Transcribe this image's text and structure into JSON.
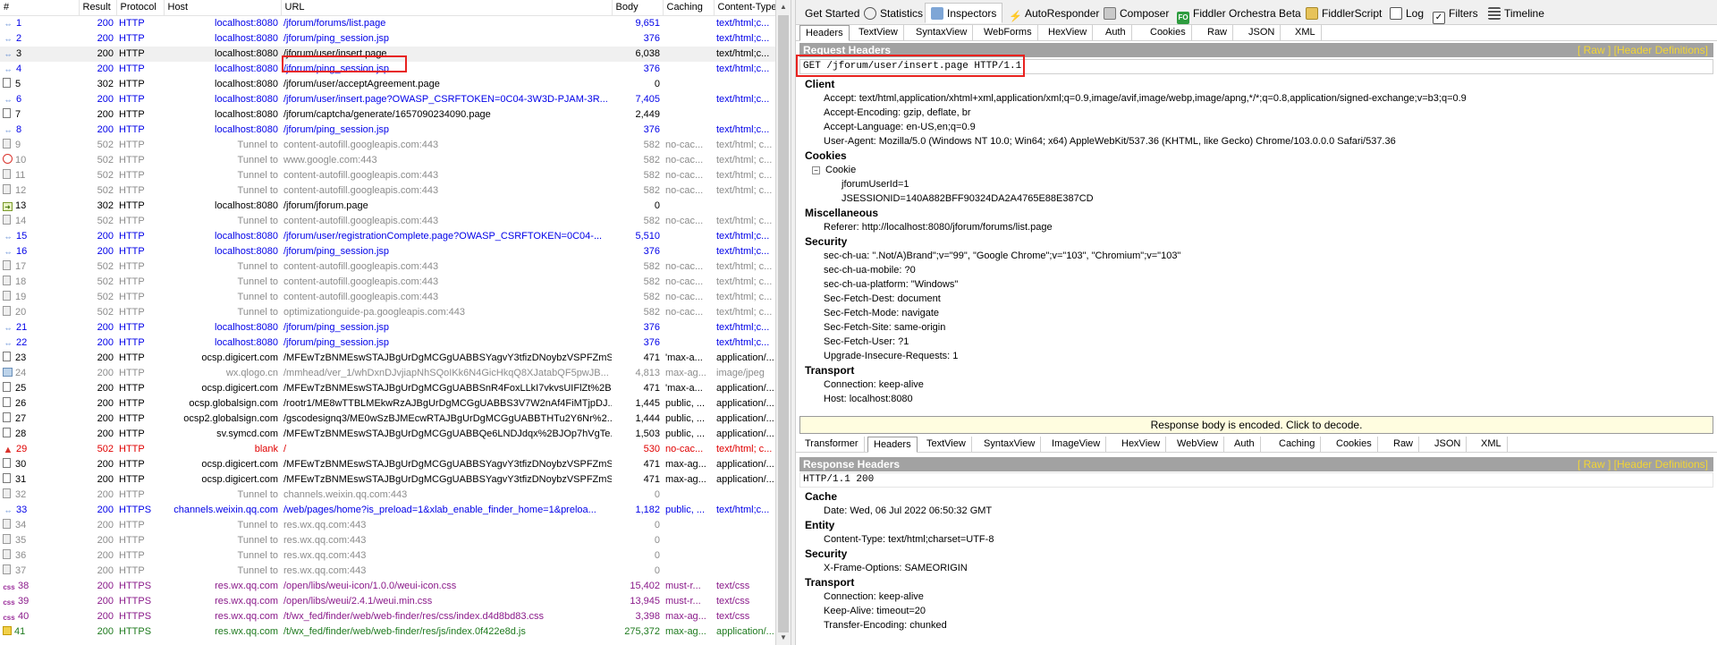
{
  "sessions": {
    "columns": [
      "#",
      "Result",
      "Protocol",
      "Host",
      "URL",
      "Body",
      "Caching",
      "Content-Type"
    ],
    "rows": [
      {
        "n": "1",
        "result": "200",
        "protocol": "HTTP",
        "host": "localhost:8080",
        "url": "/jforum/forums/list.page",
        "body": "9,651",
        "caching": "",
        "ctype": "text/html;c...",
        "color": "blue",
        "icon": "arrows"
      },
      {
        "n": "2",
        "result": "200",
        "protocol": "HTTP",
        "host": "localhost:8080",
        "url": "/jforum/ping_session.jsp",
        "body": "376",
        "caching": "",
        "ctype": "text/html;c...",
        "color": "blue",
        "icon": "arrows"
      },
      {
        "n": "3",
        "result": "200",
        "protocol": "HTTP",
        "host": "localhost:8080",
        "url": "/jforum/user/insert.page",
        "body": "6,038",
        "caching": "",
        "ctype": "text/html;c...",
        "color": "black",
        "icon": "arrows",
        "selected": true
      },
      {
        "n": "4",
        "result": "200",
        "protocol": "HTTP",
        "host": "localhost:8080",
        "url": "/jforum/ping_session.jsp",
        "body": "376",
        "caching": "",
        "ctype": "text/html;c...",
        "color": "blue",
        "icon": "arrows"
      },
      {
        "n": "5",
        "result": "302",
        "protocol": "HTTP",
        "host": "localhost:8080",
        "url": "/jforum/user/acceptAgreement.page",
        "body": "0",
        "caching": "",
        "ctype": "",
        "color": "black",
        "icon": "page"
      },
      {
        "n": "6",
        "result": "200",
        "protocol": "HTTP",
        "host": "localhost:8080",
        "url": "/jforum/user/insert.page?OWASP_CSRFTOKEN=0C04-3W3D-PJAM-3R...",
        "body": "7,405",
        "caching": "",
        "ctype": "text/html;c...",
        "color": "blue",
        "icon": "arrows"
      },
      {
        "n": "7",
        "result": "200",
        "protocol": "HTTP",
        "host": "localhost:8080",
        "url": "/jforum/captcha/generate/1657090234090.page",
        "body": "2,449",
        "caching": "",
        "ctype": "",
        "color": "black",
        "icon": "page"
      },
      {
        "n": "8",
        "result": "200",
        "protocol": "HTTP",
        "host": "localhost:8080",
        "url": "/jforum/ping_session.jsp",
        "body": "376",
        "caching": "",
        "ctype": "text/html;c...",
        "color": "blue",
        "icon": "arrows"
      },
      {
        "n": "9",
        "result": "502",
        "protocol": "HTTP",
        "host": "Tunnel to",
        "url": "content-autofill.googleapis.com:443",
        "body": "582",
        "caching": "no-cac...",
        "ctype": "text/html; c...",
        "color": "gray",
        "icon": "lock"
      },
      {
        "n": "10",
        "result": "502",
        "protocol": "HTTP",
        "host": "Tunnel to",
        "url": "www.google.com:443",
        "body": "582",
        "caching": "no-cac...",
        "ctype": "text/html; c...",
        "color": "gray",
        "icon": "block"
      },
      {
        "n": "11",
        "result": "502",
        "protocol": "HTTP",
        "host": "Tunnel to",
        "url": "content-autofill.googleapis.com:443",
        "body": "582",
        "caching": "no-cac...",
        "ctype": "text/html; c...",
        "color": "gray",
        "icon": "lock"
      },
      {
        "n": "12",
        "result": "502",
        "protocol": "HTTP",
        "host": "Tunnel to",
        "url": "content-autofill.googleapis.com:443",
        "body": "582",
        "caching": "no-cac...",
        "ctype": "text/html; c...",
        "color": "gray",
        "icon": "lock"
      },
      {
        "n": "13",
        "result": "302",
        "protocol": "HTTP",
        "host": "localhost:8080",
        "url": "/jforum/jforum.page",
        "body": "0",
        "caching": "",
        "ctype": "",
        "color": "black",
        "icon": "redirect"
      },
      {
        "n": "14",
        "result": "502",
        "protocol": "HTTP",
        "host": "Tunnel to",
        "url": "content-autofill.googleapis.com:443",
        "body": "582",
        "caching": "no-cac...",
        "ctype": "text/html; c...",
        "color": "gray",
        "icon": "lock"
      },
      {
        "n": "15",
        "result": "200",
        "protocol": "HTTP",
        "host": "localhost:8080",
        "url": "/jforum/user/registrationComplete.page?OWASP_CSRFTOKEN=0C04-...",
        "body": "5,510",
        "caching": "",
        "ctype": "text/html;c...",
        "color": "blue",
        "icon": "arrows"
      },
      {
        "n": "16",
        "result": "200",
        "protocol": "HTTP",
        "host": "localhost:8080",
        "url": "/jforum/ping_session.jsp",
        "body": "376",
        "caching": "",
        "ctype": "text/html;c...",
        "color": "blue",
        "icon": "arrows"
      },
      {
        "n": "17",
        "result": "502",
        "protocol": "HTTP",
        "host": "Tunnel to",
        "url": "content-autofill.googleapis.com:443",
        "body": "582",
        "caching": "no-cac...",
        "ctype": "text/html; c...",
        "color": "gray",
        "icon": "lock"
      },
      {
        "n": "18",
        "result": "502",
        "protocol": "HTTP",
        "host": "Tunnel to",
        "url": "content-autofill.googleapis.com:443",
        "body": "582",
        "caching": "no-cac...",
        "ctype": "text/html; c...",
        "color": "gray",
        "icon": "lock"
      },
      {
        "n": "19",
        "result": "502",
        "protocol": "HTTP",
        "host": "Tunnel to",
        "url": "content-autofill.googleapis.com:443",
        "body": "582",
        "caching": "no-cac...",
        "ctype": "text/html; c...",
        "color": "gray",
        "icon": "lock"
      },
      {
        "n": "20",
        "result": "502",
        "protocol": "HTTP",
        "host": "Tunnel to",
        "url": "optimizationguide-pa.googleapis.com:443",
        "body": "582",
        "caching": "no-cac...",
        "ctype": "text/html; c...",
        "color": "gray",
        "icon": "lock"
      },
      {
        "n": "21",
        "result": "200",
        "protocol": "HTTP",
        "host": "localhost:8080",
        "url": "/jforum/ping_session.jsp",
        "body": "376",
        "caching": "",
        "ctype": "text/html;c...",
        "color": "blue",
        "icon": "arrows"
      },
      {
        "n": "22",
        "result": "200",
        "protocol": "HTTP",
        "host": "localhost:8080",
        "url": "/jforum/ping_session.jsp",
        "body": "376",
        "caching": "",
        "ctype": "text/html;c...",
        "color": "blue",
        "icon": "arrows"
      },
      {
        "n": "23",
        "result": "200",
        "protocol": "HTTP",
        "host": "ocsp.digicert.com",
        "url": "/MFEwTzBNMEswSTAJBgUrDgMCGgUABBSYagvY3tfizDNoybzVSPFZmS...",
        "body": "471",
        "caching": "'max-a...",
        "ctype": "application/...",
        "color": "black",
        "icon": "page"
      },
      {
        "n": "24",
        "result": "200",
        "protocol": "HTTP",
        "host": "wx.qlogo.cn",
        "url": "/mmhead/ver_1/whDxnDJvjiapNhSQoIKk6N4GicHkqQ8XJatabQF5pwJB...",
        "body": "4,813",
        "caching": "max-ag...",
        "ctype": "image/jpeg",
        "color": "dim",
        "icon": "img"
      },
      {
        "n": "25",
        "result": "200",
        "protocol": "HTTP",
        "host": "ocsp.digicert.com",
        "url": "/MFEwTzBNMEswSTAJBgUrDgMCGgUABBSnR4FoxLLkI7vkvsUIFlZt%2B...",
        "body": "471",
        "caching": "'max-a...",
        "ctype": "application/...",
        "color": "black",
        "icon": "page"
      },
      {
        "n": "26",
        "result": "200",
        "protocol": "HTTP",
        "host": "ocsp.globalsign.com",
        "url": "/rootr1/ME8wTTBLMEkwRzAJBgUrDgMCGgUABBS3V7W2nAf4FiMTjpDJ...",
        "body": "1,445",
        "caching": "public, ...",
        "ctype": "application/...",
        "color": "black",
        "icon": "page"
      },
      {
        "n": "27",
        "result": "200",
        "protocol": "HTTP",
        "host": "ocsp2.globalsign.com",
        "url": "/gscodesignq3/ME0wSzBJMEcwRTAJBgUrDgMCGgUABBTHTu2Y6Nr%2...",
        "body": "1,444",
        "caching": "public, ...",
        "ctype": "application/...",
        "color": "black",
        "icon": "page"
      },
      {
        "n": "28",
        "result": "200",
        "protocol": "HTTP",
        "host": "sv.symcd.com",
        "url": "/MFEwTzBNMEswSTAJBgUrDgMCGgUABBQe6LNDJdqx%2BJOp7hVgTe...",
        "body": "1,503",
        "caching": "public, ...",
        "ctype": "application/...",
        "color": "black",
        "icon": "page"
      },
      {
        "n": "29",
        "result": "502",
        "protocol": "HTTP",
        "host": "blank",
        "url": "/",
        "body": "530",
        "caching": "no-cac...",
        "ctype": "text/html; c...",
        "color": "red",
        "icon": "warn"
      },
      {
        "n": "30",
        "result": "200",
        "protocol": "HTTP",
        "host": "ocsp.digicert.com",
        "url": "/MFEwTzBNMEswSTAJBgUrDgMCGgUABBSYagvY3tfizDNoybzVSPFZmS...",
        "body": "471",
        "caching": "max-ag...",
        "ctype": "application/...",
        "color": "black",
        "icon": "page"
      },
      {
        "n": "31",
        "result": "200",
        "protocol": "HTTP",
        "host": "ocsp.digicert.com",
        "url": "/MFEwTzBNMEswSTAJBgUrDgMCGgUABBSYagvY3tfizDNoybzVSPFZmS...",
        "body": "471",
        "caching": "max-ag...",
        "ctype": "application/...",
        "color": "black",
        "icon": "page"
      },
      {
        "n": "32",
        "result": "200",
        "protocol": "HTTP",
        "host": "Tunnel to",
        "url": "channels.weixin.qq.com:443",
        "body": "0",
        "caching": "",
        "ctype": "",
        "color": "gray",
        "icon": "lock"
      },
      {
        "n": "33",
        "result": "200",
        "protocol": "HTTPS",
        "host": "channels.weixin.qq.com",
        "url": "/web/pages/home?is_preload=1&xlab_enable_finder_home=1&preloa...",
        "body": "1,182",
        "caching": "public, ...",
        "ctype": "text/html;c...",
        "color": "blue",
        "icon": "arrows"
      },
      {
        "n": "34",
        "result": "200",
        "protocol": "HTTP",
        "host": "Tunnel to",
        "url": "res.wx.qq.com:443",
        "body": "0",
        "caching": "",
        "ctype": "",
        "color": "gray",
        "icon": "lock"
      },
      {
        "n": "35",
        "result": "200",
        "protocol": "HTTP",
        "host": "Tunnel to",
        "url": "res.wx.qq.com:443",
        "body": "0",
        "caching": "",
        "ctype": "",
        "color": "gray",
        "icon": "lock"
      },
      {
        "n": "36",
        "result": "200",
        "protocol": "HTTP",
        "host": "Tunnel to",
        "url": "res.wx.qq.com:443",
        "body": "0",
        "caching": "",
        "ctype": "",
        "color": "gray",
        "icon": "lock"
      },
      {
        "n": "37",
        "result": "200",
        "protocol": "HTTP",
        "host": "Tunnel to",
        "url": "res.wx.qq.com:443",
        "body": "0",
        "caching": "",
        "ctype": "",
        "color": "gray",
        "icon": "lock"
      },
      {
        "n": "38",
        "result": "200",
        "protocol": "HTTPS",
        "host": "res.wx.qq.com",
        "url": "/open/libs/weui-icon/1.0.0/weui-icon.css",
        "body": "15,402",
        "caching": "must-r...",
        "ctype": "text/css",
        "color": "purple",
        "icon": "css"
      },
      {
        "n": "39",
        "result": "200",
        "protocol": "HTTPS",
        "host": "res.wx.qq.com",
        "url": "/open/libs/weui/2.4.1/weui.min.css",
        "body": "13,945",
        "caching": "must-r...",
        "ctype": "text/css",
        "color": "purple",
        "icon": "css"
      },
      {
        "n": "40",
        "result": "200",
        "protocol": "HTTPS",
        "host": "res.wx.qq.com",
        "url": "/t/wx_fed/finder/web/web-finder/res/css/index.d4d8bd83.css",
        "body": "3,398",
        "caching": "max-ag...",
        "ctype": "text/css",
        "color": "purple",
        "icon": "css"
      },
      {
        "n": "41",
        "result": "200",
        "protocol": "HTTPS",
        "host": "res.wx.qq.com",
        "url": "/t/wx_fed/finder/web/web-finder/res/js/index.0f422e8d.js",
        "body": "275,372",
        "caching": "max-ag...",
        "ctype": "application/...",
        "color": "green",
        "icon": "js"
      }
    ]
  },
  "top_tabs": [
    {
      "label": "Get Started",
      "icon": ""
    },
    {
      "label": "Statistics",
      "icon": "stats-icon"
    },
    {
      "label": "Inspectors",
      "icon": "inspect-icon",
      "active": true
    },
    {
      "label": "AutoResponder",
      "icon": "bolt-icon"
    },
    {
      "label": "Composer",
      "icon": "compose-icon"
    },
    {
      "label": "Fiddler Orchestra Beta",
      "icon": "fo-icon"
    },
    {
      "label": "FiddlerScript",
      "icon": "script-icon"
    },
    {
      "label": "Log",
      "icon": "log-icon"
    },
    {
      "label": "Filters",
      "icon": "filter-icon"
    },
    {
      "label": "Timeline",
      "icon": "timeline-icon"
    }
  ],
  "request_tabs": [
    "Headers",
    "TextView",
    "SyntaxView",
    "WebForms",
    "HexView",
    "Auth",
    "Cookies",
    "Raw",
    "JSON",
    "XML"
  ],
  "request": {
    "title": "Request Headers",
    "links": "[ Raw ]   [Header Definitions]",
    "line": "GET /jforum/user/insert.page HTTP/1.1",
    "client_label": "Client",
    "client": [
      "Accept: text/html,application/xhtml+xml,application/xml;q=0.9,image/avif,image/webp,image/apng,*/*;q=0.8,application/signed-exchange;v=b3;q=0.9",
      "Accept-Encoding: gzip, deflate, br",
      "Accept-Language: en-US,en;q=0.9",
      "User-Agent: Mozilla/5.0 (Windows NT 10.0; Win64; x64) AppleWebKit/537.36 (KHTML, like Gecko) Chrome/103.0.0.0 Safari/537.36"
    ],
    "cookies_label": "Cookies",
    "cookie_node": "Cookie",
    "cookies": [
      "jforumUserId=1",
      "JSESSIONID=140A882BFF90324DA2A4765E88E387CD"
    ],
    "misc_label": "Miscellaneous",
    "misc": [
      "Referer: http://localhost:8080/jforum/forums/list.page"
    ],
    "security_label": "Security",
    "security": [
      "sec-ch-ua: \".Not/A)Brand\";v=\"99\", \"Google Chrome\";v=\"103\", \"Chromium\";v=\"103\"",
      "sec-ch-ua-mobile: ?0",
      "sec-ch-ua-platform: \"Windows\"",
      "Sec-Fetch-Dest: document",
      "Sec-Fetch-Mode: navigate",
      "Sec-Fetch-Site: same-origin",
      "Sec-Fetch-User: ?1",
      "Upgrade-Insecure-Requests: 1"
    ],
    "transport_label": "Transport",
    "transport": [
      "Connection: keep-alive",
      "Host: localhost:8080"
    ]
  },
  "encoded_notice": "Response body is encoded. Click to decode.",
  "response_tabs": [
    "Transformer",
    "Headers",
    "TextView",
    "SyntaxView",
    "ImageView",
    "HexView",
    "WebView",
    "Auth",
    "Caching",
    "Cookies",
    "Raw",
    "JSON",
    "XML"
  ],
  "response": {
    "title": "Response Headers",
    "links": "[ Raw ]   [Header Definitions]",
    "line": "HTTP/1.1 200",
    "cache_label": "Cache",
    "cache": [
      "Date: Wed, 06 Jul 2022 06:50:32 GMT"
    ],
    "entity_label": "Entity",
    "entity": [
      "Content-Type: text/html;charset=UTF-8"
    ],
    "security_label": "Security",
    "security": [
      "X-Frame-Options: SAMEORIGIN"
    ],
    "transport_label": "Transport",
    "transport": [
      "Connection: keep-alive",
      "Keep-Alive: timeout=20",
      "Transfer-Encoding: chunked"
    ]
  },
  "colors": {
    "blue": "#0000e8",
    "gray": "#8c8c8c",
    "red": "#e00000",
    "purple": "#8a1a8a",
    "green": "#1e7a1e",
    "highlight": "#e8221f",
    "header_bar": "#a2a2a2",
    "link_gold": "#f3d533"
  }
}
